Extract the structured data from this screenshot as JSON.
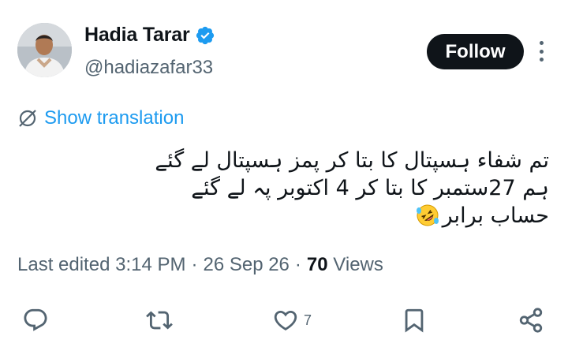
{
  "author": {
    "display_name": "Hadia Tarar",
    "handle": "@hadiazafar33",
    "verified": true,
    "avatar_icon": "profile-photo"
  },
  "header": {
    "follow_label": "Follow",
    "more_icon": "more-vertical-icon"
  },
  "translation": {
    "label": "Show translation",
    "icon": "translate-icon",
    "color": "#1d9bf0"
  },
  "tweet": {
    "lines": [
      "تم شفاء ہسپتال کا بتا کر پمز ہسپتال  لے گئے",
      "ہم 27ستمبر کا بتا کر 4 اکتوبر پہ لے گئے",
      "حساب برابر"
    ],
    "emoji": "rolling-on-the-floor-laughing"
  },
  "meta": {
    "edited_label": "Last edited 3:14 PM",
    "separator": "·",
    "date": "26 Sep 26",
    "views_count": "70",
    "views_label": "Views"
  },
  "actions": {
    "reply_icon": "reply-icon",
    "retweet_icon": "retweet-icon",
    "like_icon": "heart-icon",
    "like_count": "7",
    "bookmark_icon": "bookmark-icon",
    "share_icon": "share-icon"
  },
  "colors": {
    "text": "#0f1419",
    "secondary": "#536471",
    "verified": "#1d9bf0",
    "follow_bg": "#0f1419"
  }
}
